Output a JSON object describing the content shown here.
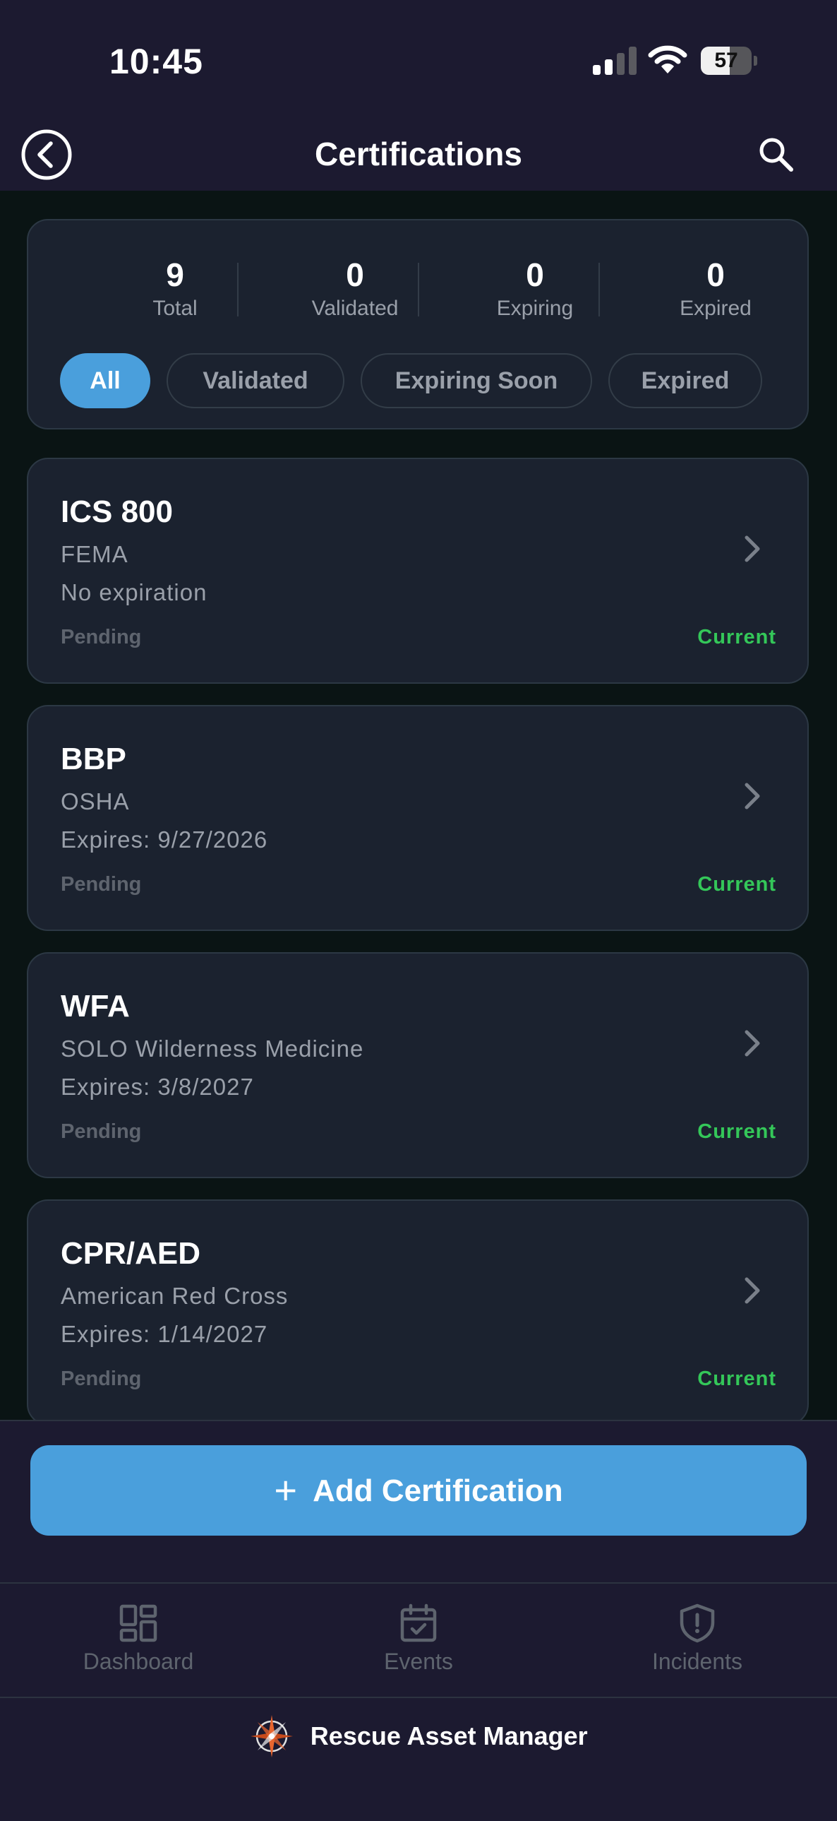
{
  "status_bar": {
    "time": "10:45",
    "battery_percent": "57",
    "battery_level": 0.57,
    "wifi": "wifi-icon",
    "signal": "cellular-signal-icon"
  },
  "header": {
    "title": "Certifications",
    "back_icon": "back-circle-icon",
    "search_icon": "search-icon"
  },
  "summary": {
    "stats": [
      {
        "value": "9",
        "label": "Total"
      },
      {
        "value": "0",
        "label": "Validated"
      },
      {
        "value": "0",
        "label": "Expiring"
      },
      {
        "value": "0",
        "label": "Expired"
      }
    ],
    "filters": [
      {
        "label": "All",
        "selected": true
      },
      {
        "label": "Validated",
        "selected": false
      },
      {
        "label": "Expiring Soon",
        "selected": false
      },
      {
        "label": "Expired",
        "selected": false
      }
    ]
  },
  "certifications": [
    {
      "name": "ICS 800",
      "issuer": "FEMA",
      "expiry": "No expiration",
      "validation": "Pending",
      "status": "Current"
    },
    {
      "name": "BBP",
      "issuer": "OSHA",
      "expiry": "Expires: 9/27/2026",
      "validation": "Pending",
      "status": "Current"
    },
    {
      "name": "WFA",
      "issuer": "SOLO Wilderness Medicine",
      "expiry": "Expires: 3/8/2027",
      "validation": "Pending",
      "status": "Current"
    },
    {
      "name": "CPR/AED",
      "issuer": "American Red Cross",
      "expiry": "Expires: 1/14/2027",
      "validation": "Pending",
      "status": "Current"
    }
  ],
  "actions": {
    "add_label": "Add Certification",
    "add_icon": "plus-icon"
  },
  "tabs": [
    {
      "label": "Dashboard",
      "icon": "dashboard-grid-icon"
    },
    {
      "label": "Events",
      "icon": "calendar-check-icon"
    },
    {
      "label": "Incidents",
      "icon": "shield-alert-icon"
    }
  ],
  "brand": {
    "name": "Rescue Asset Manager",
    "logo": "compass-rose-logo"
  },
  "colors": {
    "accent": "#4a9fdc",
    "status_current": "#34c759",
    "background": "#0a1414",
    "surface": "#1b222f",
    "bar": "#1c1a30"
  }
}
